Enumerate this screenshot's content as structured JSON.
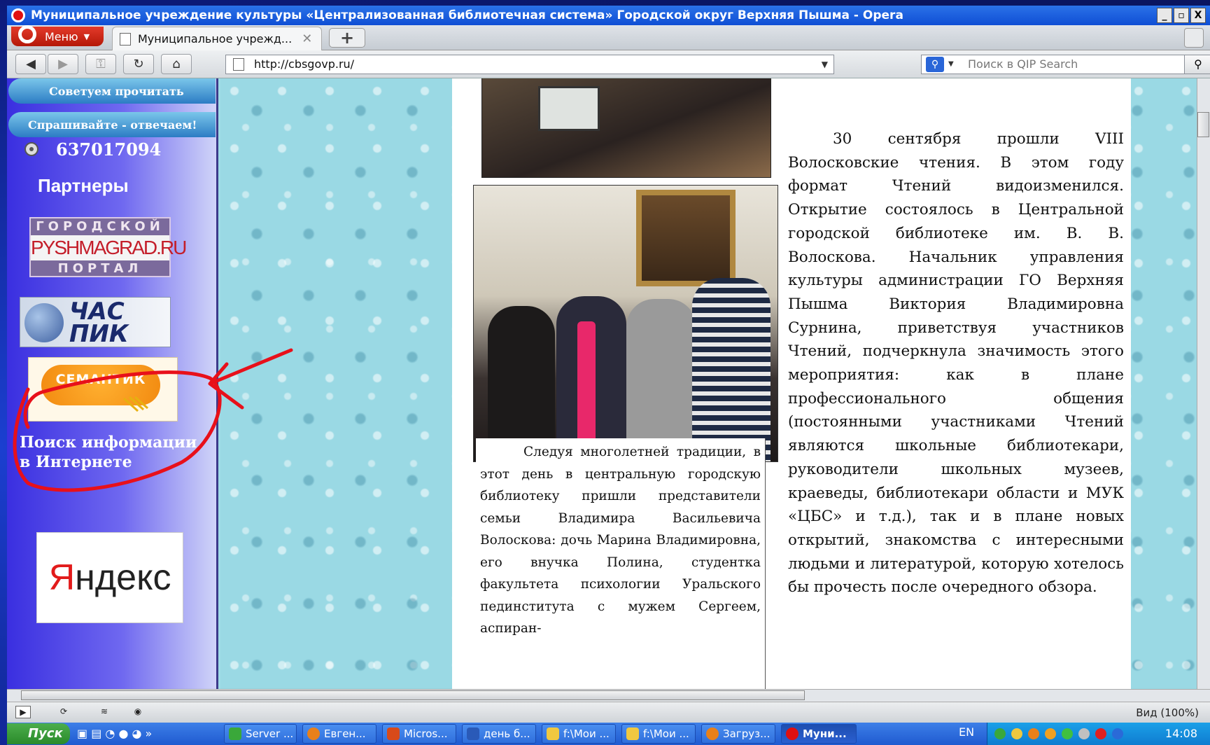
{
  "window": {
    "title": "Муниципальное учреждение культуры «Централизованная библиотечная система» Городской округ Верхняя Пышма - Opera",
    "controls": [
      "_",
      "▫",
      "X"
    ]
  },
  "tabbar": {
    "menu_label": "Меню",
    "active_tab": "Муниципальное учрежд...",
    "new_tab_label": "+"
  },
  "navbar": {
    "url": "http://cbsgovp.ru/",
    "search_placeholder": "Поиск в QIP Search"
  },
  "sidebar": {
    "buttons": [
      "Советуем прочитать",
      "Спрашивайте - отвечаем!"
    ],
    "counter": "637017094",
    "partners_heading": "Партнеры",
    "pyshma_logo": {
      "top": "ГОРОДСКОЙ",
      "mid": "PYSHMAGRAD.RU",
      "bottom": "ПОРТАЛ"
    },
    "chaspik_logo": "ЧАС ПИК",
    "semantik_logo": "СЕМАНТИК",
    "search_info": "Поиск информации в Интернете",
    "yandex": {
      "first": "Я",
      "rest": "ндекс"
    }
  },
  "caption": {
    "text": "Следуя многолетней традиции, в этот день в центральную городскую библиотеку пришли представители семьи Владимира Васильевича Волоскова: дочь Марина Владимировна, его внучка Полина, студентка факультета психологии Уральского пединститута с мужем Сергеем, аспиран-"
  },
  "article": {
    "text": "30 сентября прошли VIII Волосковские чтения. В этом году формат Чтений видоизменился. Открытие состоялось в Центральной городской библиотеке им. В. В. Волоскова. Начальник управления культуры администрации ГО Верхняя Пышма Виктория Владимировна Сурнина, приветствуя участников Чтений, подчеркнула значимость этого мероприятия: как в плане профессионального общения (постоянными участниками Чтений являются школьные библиотекари, руководители школьных музеев, краеведы, библиотекари области и МУК «ЦБС» и т.д.), так и в плане новых открытий, знакомства с интересными людьми и литературой, которую хотелось бы прочесть после очередного обзора."
  },
  "statusbar": {
    "zoom": "Вид (100%)"
  },
  "taskbar": {
    "start": "Пуск",
    "items": [
      "Server ...",
      "Евген...",
      "Micros...",
      "день б...",
      "f:\\Мои ...",
      "f:\\Мои ...",
      "Загруз...",
      "Муни..."
    ],
    "lang": "EN",
    "clock": "14:08"
  },
  "colors": {
    "titlebar": "#0f4ed4",
    "sidebar": "#3a2fe0",
    "water": "#9ad9e4",
    "annotation": "#e8101a",
    "opera_red": "#e01010"
  }
}
